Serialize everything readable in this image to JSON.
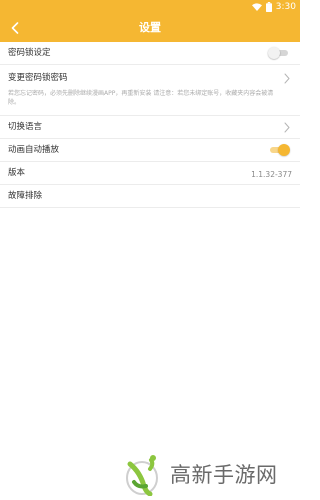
{
  "status_bar": {
    "time": "3:30",
    "icons": [
      "wifi-icon",
      "battery-icon"
    ]
  },
  "toolbar": {
    "back_icon": "chevron-left-icon",
    "title": "设置"
  },
  "settings": {
    "password_lock": {
      "label": "密码锁设定",
      "enabled": false
    },
    "change_password": {
      "label": "变更密码锁密码",
      "description": "若您忘记密码，必须先删除继续漫画APP，再重新安装 请注意：若您未绑定账号，收藏夹内容会被清除。"
    },
    "language": {
      "label": "切换语言"
    },
    "autoplay_animation": {
      "label": "动画自动播放",
      "enabled": true
    },
    "version": {
      "label": "版本",
      "value": "1.1.32-377"
    },
    "troubleshoot": {
      "label": "故障排除"
    }
  },
  "watermark": {
    "text": "高新手游网"
  },
  "colors": {
    "accent": "#f5b732",
    "toggle_off_track": "#d6d6d6",
    "divider": "#ececec",
    "description_text": "#aaaaaa"
  }
}
